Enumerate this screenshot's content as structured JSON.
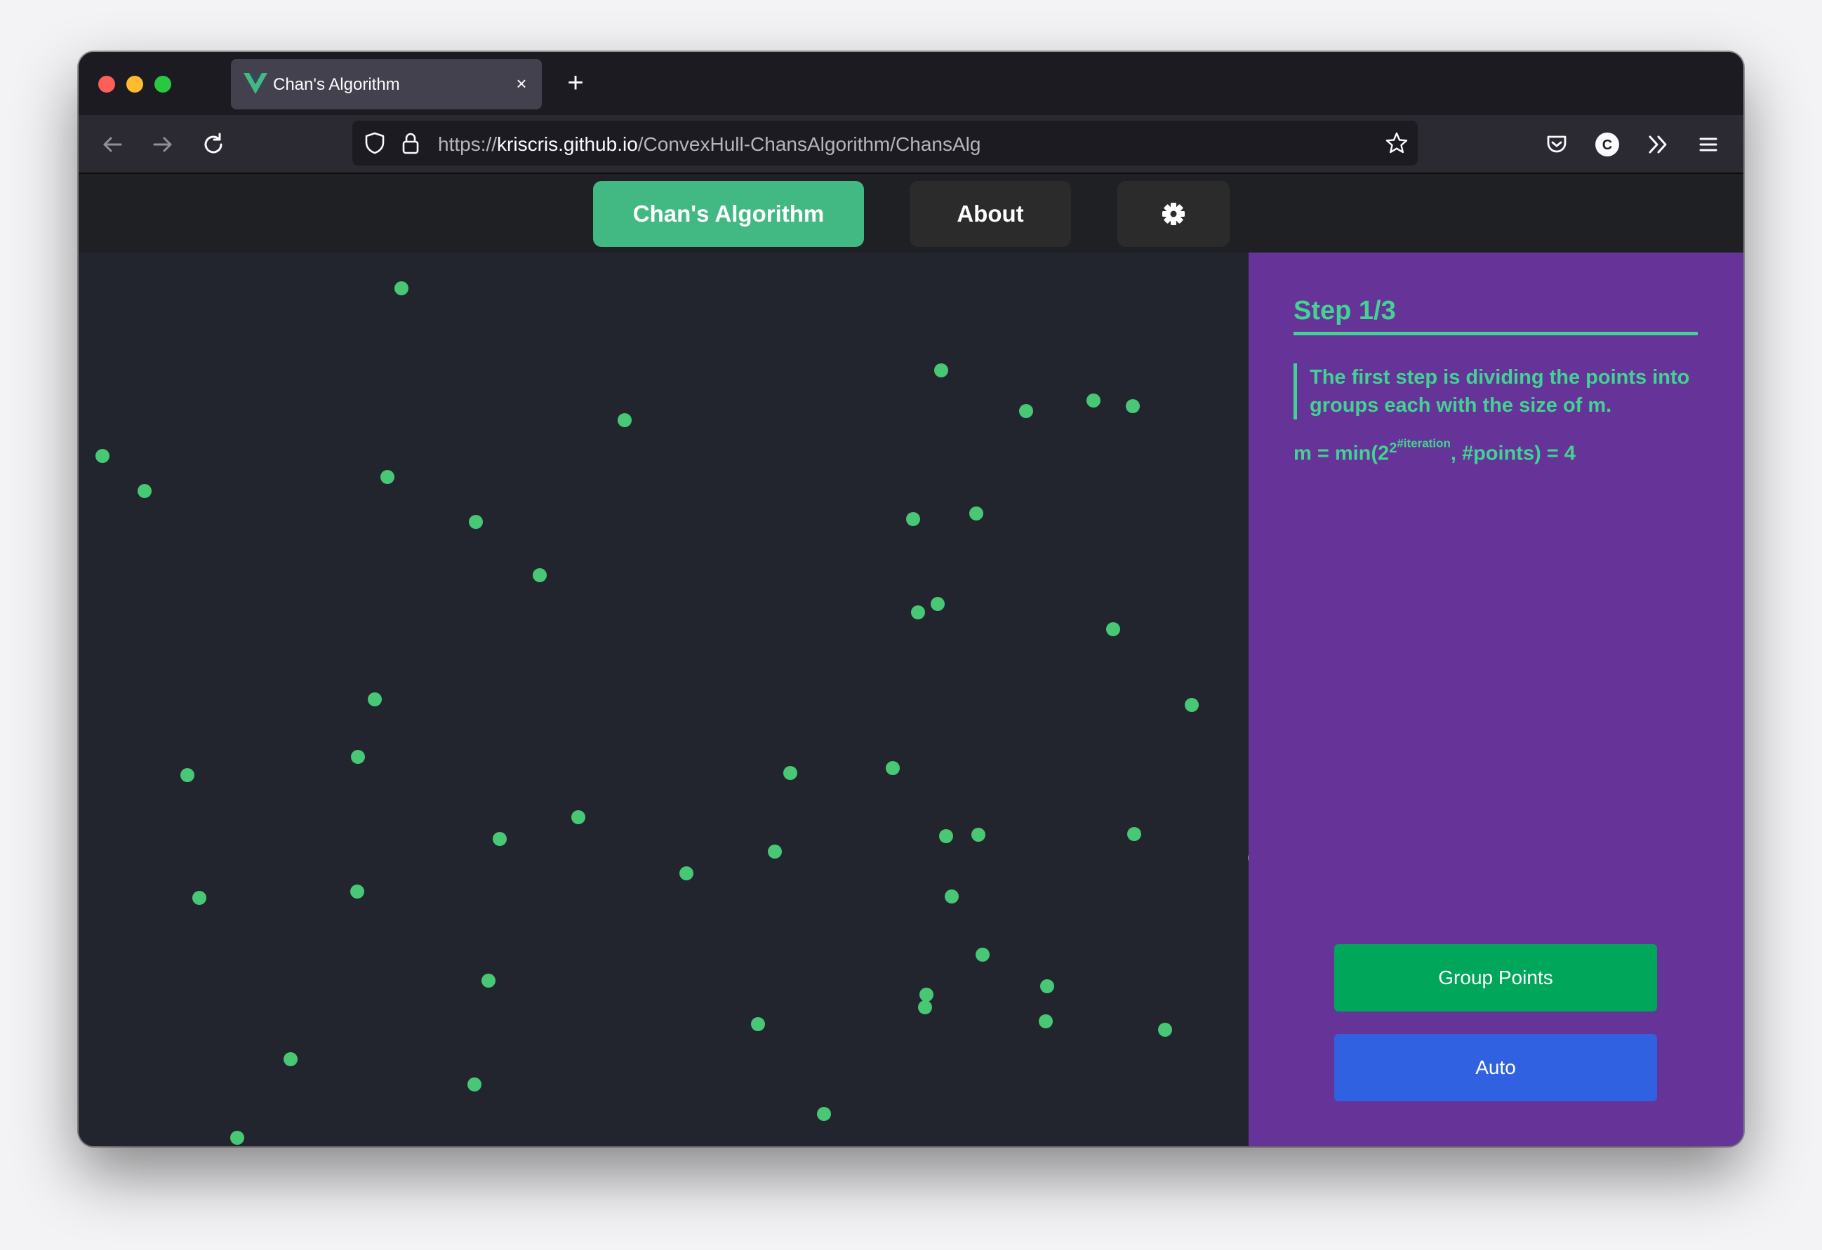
{
  "browser": {
    "tab_title": "Chan's Algorithm",
    "tab_close": "×",
    "new_tab": "+",
    "url_scheme": "https://",
    "url_host": "kriscris.github.io",
    "url_path": "/ConvexHull-ChansAlgorithm/ChansAlg"
  },
  "app_nav": {
    "primary_label": "Chan's Algorithm",
    "about_label": "About",
    "settings_icon": "gear-icon"
  },
  "panel": {
    "step_title": "Step 1/3",
    "description": "The first step is dividing the points into groups each with the size of m.",
    "formula_prefix": "m = min(2",
    "formula_base2": "2",
    "formula_exponent": "#iteration",
    "formula_suffix": ", #points) = 4",
    "group_button": "Group Points",
    "auto_button": "Auto"
  },
  "colors": {
    "accent_green": "#42b983",
    "point_color": "#48c774",
    "panel_purple": "#663399",
    "group_button": "#00a65a",
    "auto_button": "#3061e0"
  }
}
